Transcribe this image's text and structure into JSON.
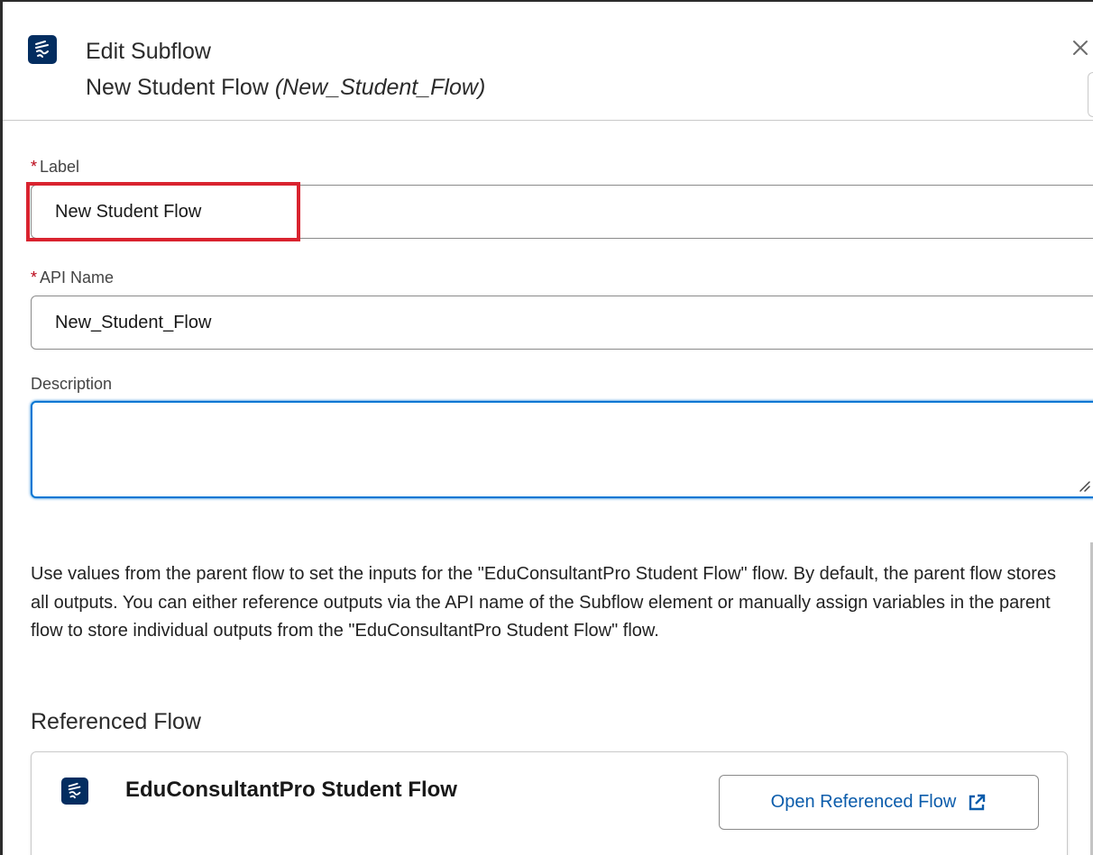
{
  "header": {
    "title": "Edit Subflow",
    "flow_label": "New Student Flow",
    "flow_api_display": "(New_Student_Flow)",
    "close_symbol": "×",
    "icon": "flow-icon"
  },
  "fields": {
    "label": {
      "required_mark": "*",
      "label": "Label",
      "value": "New Student Flow"
    },
    "api_name": {
      "required_mark": "*",
      "label": "API Name",
      "value": "New_Student_Flow"
    },
    "description": {
      "label": "Description",
      "value": ""
    }
  },
  "info_text": "Use values from the parent flow to set the inputs for the \"EduConsultantPro Student Flow\" flow. By default, the parent flow stores all outputs. You can either reference outputs via the API name of the Subflow element or manually assign variables in the parent flow to store individual outputs from the \"EduConsultantPro Student Flow\" flow.",
  "referenced_flow": {
    "heading": "Referenced Flow",
    "name": "EduConsultantPro Student Flow",
    "open_button_label": "Open Referenced Flow",
    "icon": "flow-icon",
    "open_icon": "external-link-icon"
  },
  "colors": {
    "brand_icon_bg": "#032d60",
    "highlight_box": "#d9232f",
    "focus_border": "#0176d3",
    "link_text": "#0b5cab",
    "required": "#ba0517"
  }
}
